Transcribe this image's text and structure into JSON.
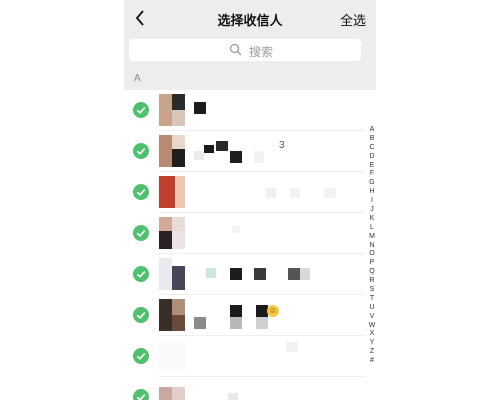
{
  "header": {
    "title": "选择收信人",
    "select_all": "全选",
    "back_icon": "chevron-left-icon"
  },
  "search": {
    "placeholder": "搜索",
    "icon": "search-icon"
  },
  "section": {
    "letter": "A"
  },
  "contacts": [
    {
      "selected": true,
      "name_visible": "",
      "trailing": ""
    },
    {
      "selected": true,
      "name_visible": "",
      "trailing": "3"
    },
    {
      "selected": true,
      "name_visible": "",
      "trailing": ""
    },
    {
      "selected": true,
      "name_visible": "",
      "trailing": ""
    },
    {
      "selected": true,
      "name_visible": "",
      "trailing": ""
    },
    {
      "selected": true,
      "name_visible": "",
      "trailing": ""
    },
    {
      "selected": true,
      "name_visible": "",
      "trailing": ""
    },
    {
      "selected": true,
      "name_visible": "",
      "trailing": ""
    }
  ],
  "index_letters": [
    "A",
    "B",
    "C",
    "D",
    "E",
    "F",
    "G",
    "H",
    "I",
    "J",
    "K",
    "L",
    "M",
    "N",
    "O",
    "P",
    "Q",
    "R",
    "S",
    "T",
    "U",
    "V",
    "W",
    "X",
    "Y",
    "Z",
    "#"
  ],
  "colors": {
    "check_green": "#4fc16e",
    "header_bg": "#ededed",
    "text": "#111111"
  }
}
